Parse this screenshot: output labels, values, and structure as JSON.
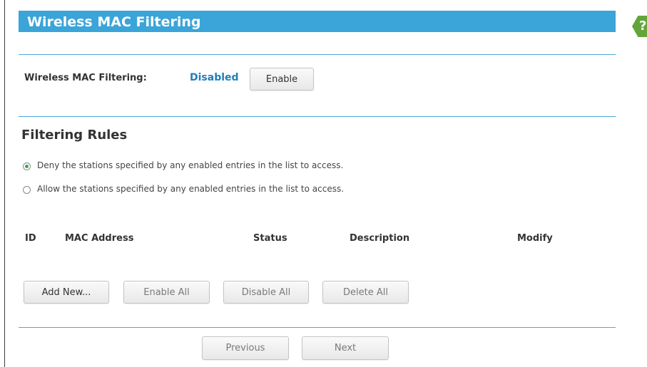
{
  "header": {
    "title": "Wireless MAC Filtering",
    "help_icon_glyph": "?"
  },
  "filtering_status": {
    "label": "Wireless MAC Filtering:",
    "value": "Disabled",
    "toggle_button": "Enable"
  },
  "rules": {
    "heading": "Filtering Rules",
    "options": [
      {
        "label": "Deny the stations specified by any enabled entries in the list to access.",
        "checked": true
      },
      {
        "label": "Allow the stations specified by any enabled entries in the list to access.",
        "checked": false
      }
    ]
  },
  "table": {
    "columns": [
      "ID",
      "MAC Address",
      "Status",
      "Description",
      "Modify"
    ],
    "rows": []
  },
  "actions": {
    "add_new": "Add New...",
    "enable_all": "Enable All",
    "disable_all": "Disable All",
    "delete_all": "Delete All"
  },
  "pagination": {
    "previous": "Previous",
    "next": "Next"
  },
  "colors": {
    "accent": "#3ba4d8",
    "status_disabled": "#1e7fb8",
    "help_icon": "#63a53a"
  }
}
